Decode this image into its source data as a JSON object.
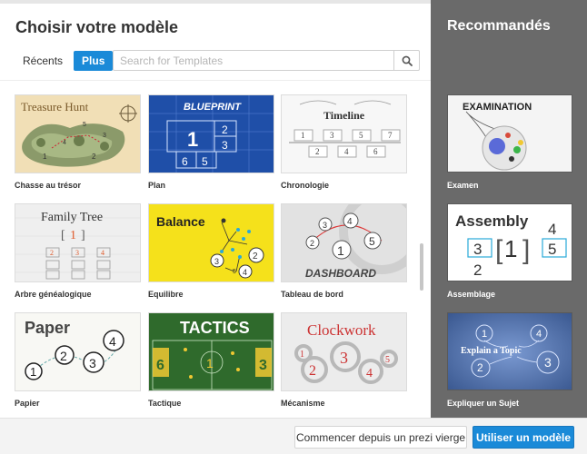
{
  "dialog": {
    "title": "Choisir votre modèle"
  },
  "tabs": [
    {
      "label": "Récents",
      "active": false
    },
    {
      "label": "Plus",
      "active": true
    }
  ],
  "search": {
    "placeholder": "Search for Templates",
    "value": "",
    "icon": "search-icon"
  },
  "templates": [
    {
      "label": "Chasse au trésor",
      "thumb_text": "Treasure Hunt"
    },
    {
      "label": "Plan",
      "thumb_text": "BLUEPRINT"
    },
    {
      "label": "Chronologie",
      "thumb_text": "Timeline"
    },
    {
      "label": "Arbre généalogique",
      "thumb_text": "Family Tree"
    },
    {
      "label": "Equilibre",
      "thumb_text": "Balance"
    },
    {
      "label": "Tableau de bord",
      "thumb_text": "DASHBOARD"
    },
    {
      "label": "Papier",
      "thumb_text": "Paper"
    },
    {
      "label": "Tactique",
      "thumb_text": "TACTICS"
    },
    {
      "label": "Mécanisme",
      "thumb_text": "Clockwork"
    }
  ],
  "sidebar": {
    "title": "Recommandés",
    "items": [
      {
        "label": "Examen",
        "thumb_text": "EXAMINATION"
      },
      {
        "label": "Assemblage",
        "thumb_text": "Assembly"
      },
      {
        "label": "Expliquer un Sujet",
        "thumb_text": "Explain a Topic"
      }
    ]
  },
  "footer": {
    "blank_button": "Commencer depuis un prezi vierge",
    "use_button": "Utiliser un modèle"
  },
  "colors": {
    "accent": "#1a8ad8",
    "sidebar_bg": "#6a6a6a"
  }
}
